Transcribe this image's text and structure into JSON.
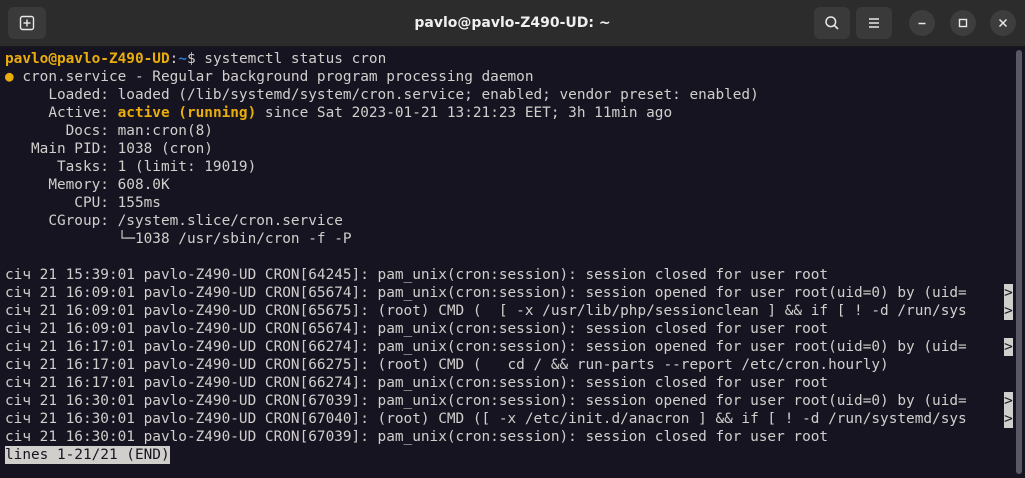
{
  "window": {
    "title": "pavlo@pavlo-Z490-UD: ~"
  },
  "icons": {
    "new_tab": "new-tab-icon",
    "search": "search-icon",
    "menu": "hamburger-menu-icon",
    "minimize": "minimize-icon",
    "maximize": "maximize-icon",
    "close": "close-icon"
  },
  "colors": {
    "terminal_bg": "#171421",
    "terminal_fg": "#d0cfcc",
    "prompt_user": "#e9ad0c",
    "prompt_path": "#2a7bde",
    "active": "#e9ad0c",
    "titlebar": "#2c2c2c"
  },
  "prompt": {
    "user_host": "pavlo@pavlo-Z490-UD",
    "colon": ":",
    "path": "~",
    "symbol": "$ ",
    "command": "systemctl status cron"
  },
  "status": {
    "bullet": "●",
    "service_line": " cron.service - Regular background program processing daemon",
    "loaded": "     Loaded: loaded (/lib/systemd/system/cron.service; enabled; vendor preset: enabled)",
    "active_label": "     Active: ",
    "active_state": "active (running)",
    "active_rest": " since Sat 2023-01-21 13:21:23 EET; 3h 11min ago",
    "docs": "       Docs: man:cron(8)",
    "main_pid": "   Main PID: 1038 (cron)",
    "tasks": "      Tasks: 1 (limit: 19019)",
    "memory": "     Memory: 608.0K",
    "cpu": "        CPU: 155ms",
    "cgroup": "     CGroup: /system.slice/cron.service",
    "cgroup_child": "             └─1038 /usr/sbin/cron -f -P"
  },
  "logs": [
    {
      "text": "січ 21 15:39:01 pavlo-Z490-UD CRON[64245]: pam_unix(cron:session): session closed for user root",
      "truncated": false
    },
    {
      "text": "січ 21 16:09:01 pavlo-Z490-UD CRON[65674]: pam_unix(cron:session): session opened for user root(uid=0) by (uid=",
      "truncated": true
    },
    {
      "text": "січ 21 16:09:01 pavlo-Z490-UD CRON[65675]: (root) CMD (  [ -x /usr/lib/php/sessionclean ] && if [ ! -d /run/sys",
      "truncated": true
    },
    {
      "text": "січ 21 16:09:01 pavlo-Z490-UD CRON[65674]: pam_unix(cron:session): session closed for user root",
      "truncated": false
    },
    {
      "text": "січ 21 16:17:01 pavlo-Z490-UD CRON[66274]: pam_unix(cron:session): session opened for user root(uid=0) by (uid=",
      "truncated": true
    },
    {
      "text": "січ 21 16:17:01 pavlo-Z490-UD CRON[66275]: (root) CMD (   cd / && run-parts --report /etc/cron.hourly)",
      "truncated": false
    },
    {
      "text": "січ 21 16:17:01 pavlo-Z490-UD CRON[66274]: pam_unix(cron:session): session closed for user root",
      "truncated": false
    },
    {
      "text": "січ 21 16:30:01 pavlo-Z490-UD CRON[67039]: pam_unix(cron:session): session opened for user root(uid=0) by (uid=",
      "truncated": true
    },
    {
      "text": "січ 21 16:30:01 pavlo-Z490-UD CRON[67040]: (root) CMD ([ -x /etc/init.d/anacron ] && if [ ! -d /run/systemd/sys",
      "truncated": true
    },
    {
      "text": "січ 21 16:30:01 pavlo-Z490-UD CRON[67039]: pam_unix(cron:session): session closed for user root",
      "truncated": false
    }
  ],
  "truncation_marker": ">",
  "pager_status": "lines 1-21/21 (END)"
}
